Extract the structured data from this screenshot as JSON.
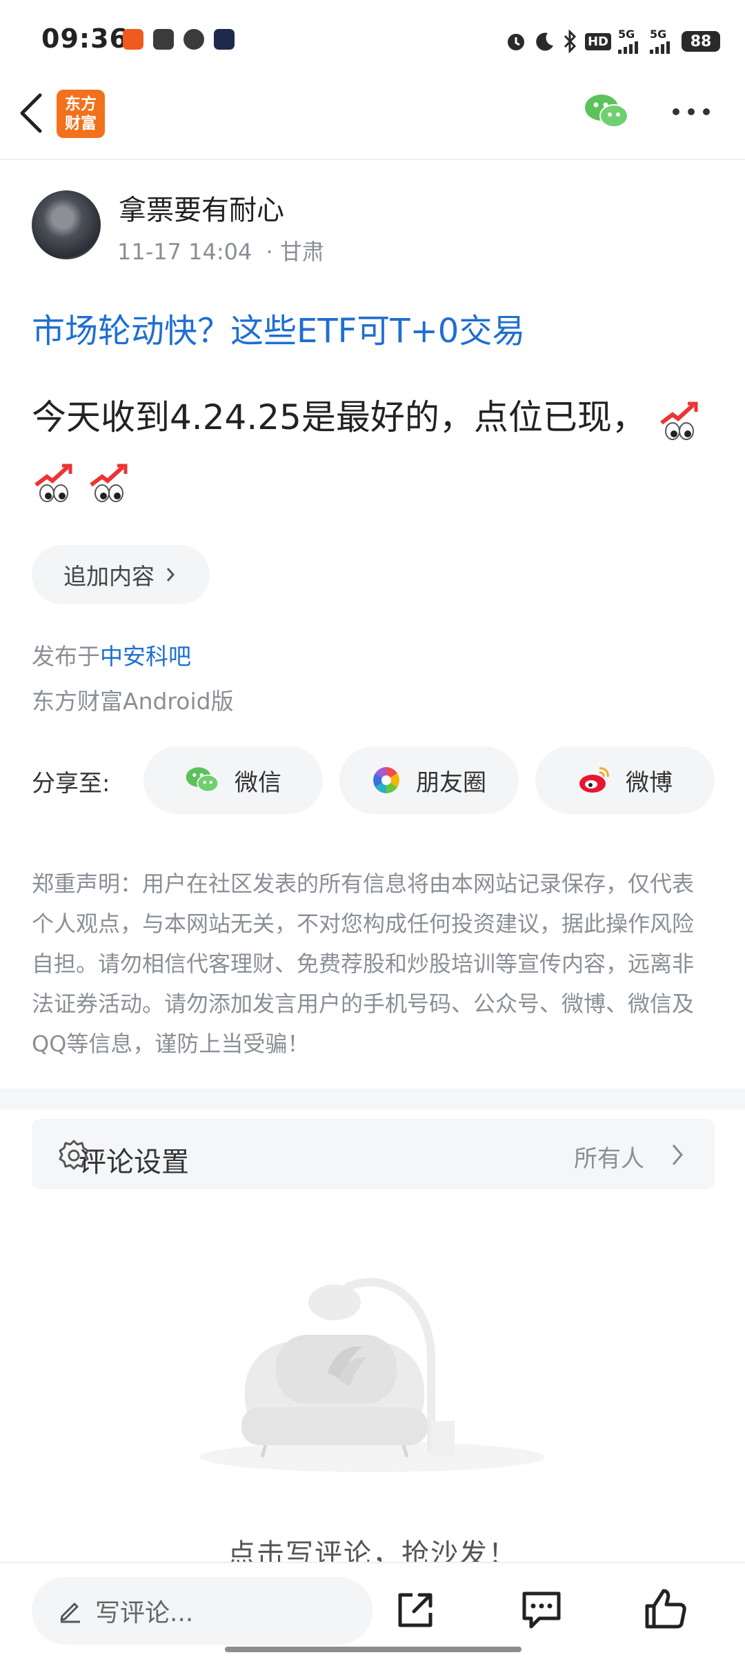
{
  "status_bar": {
    "time": "09:36",
    "battery": "88",
    "network1": "5G",
    "network2": "5G",
    "hd_label": "HD",
    "icons": [
      "alarm-icon",
      "moon-icon",
      "bluetooth-icon",
      "hd-icon",
      "signal-icon",
      "signal-icon",
      "battery-icon"
    ]
  },
  "header": {
    "logo_line1": "东方",
    "logo_line2": "财富",
    "icons": [
      "back-arrow-icon",
      "wechat-icon",
      "more-icon"
    ]
  },
  "post": {
    "author": "拿票要有耐心",
    "time": "11-17 14:04",
    "location": "· 甘肃",
    "title": "市场轮动快？这些ETF可T+0交易",
    "body": "今天收到4.24.25是最好的，点位已现，",
    "add_content": "追加内容",
    "published_prefix": "发布于",
    "published_forum": "中安科吧",
    "client": "东方财富Android版"
  },
  "share": {
    "label": "分享至:",
    "buttons": [
      {
        "label": "微信",
        "icon": "wechat-icon"
      },
      {
        "label": "朋友圈",
        "icon": "moments-icon"
      },
      {
        "label": "微博",
        "icon": "weibo-icon"
      }
    ]
  },
  "disclaimer": "郑重声明：用户在社区发表的所有信息将由本网站记录保存，仅代表个人观点，与本网站无关，不对您构成任何投资建议，据此操作风险自担。请勿相信代客理财、免费荐股和炒股培训等宣传内容，远离非法证券活动。请勿添加发言用户的手机号码、公众号、微博、微信及QQ等信息，谨防上当受骗！",
  "comment_settings": {
    "label": "评论设置",
    "value": "所有人"
  },
  "empty_state": {
    "text": "点击写评论，抢沙发！"
  },
  "bottom_bar": {
    "placeholder": "写评论...",
    "icons": [
      "share-icon",
      "comment-icon",
      "like-icon"
    ]
  },
  "colors": {
    "accent_blue": "#1f6fd1",
    "brand_orange": "#f2711c",
    "muted_text": "#8a8f96"
  }
}
